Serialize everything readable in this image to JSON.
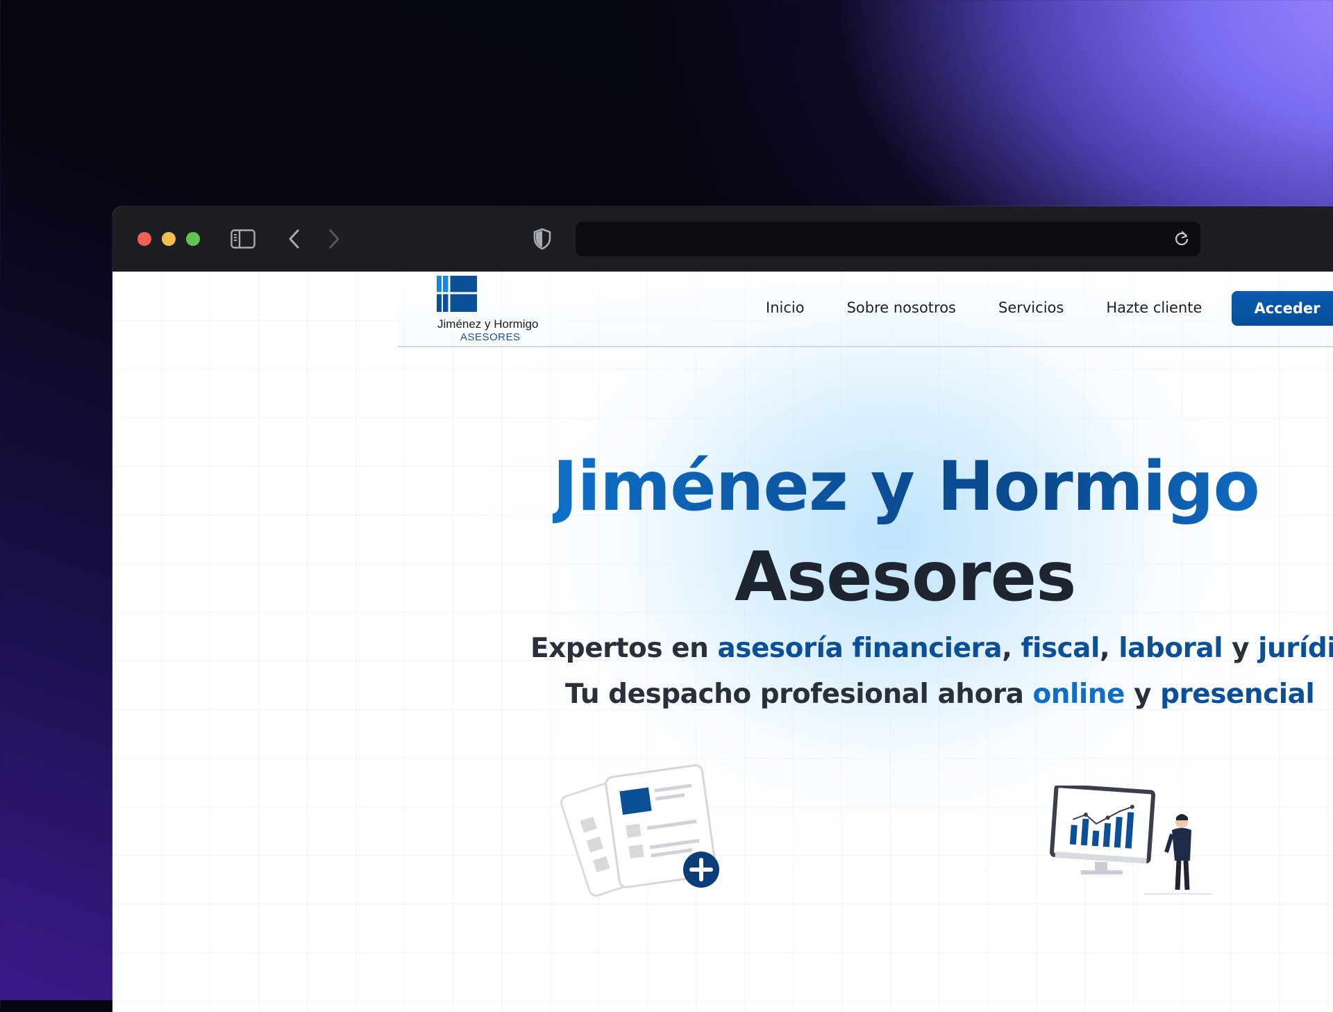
{
  "browser": {
    "url": ""
  },
  "site": {
    "logo": {
      "name": "Jiménez y Hormigo",
      "subtitle": "ASESORES"
    },
    "nav": {
      "links": [
        "Inicio",
        "Sobre nosotros",
        "Servicios",
        "Hazte cliente"
      ],
      "cta": "Acceder"
    },
    "hero": {
      "title_line1": "Jiménez y Hormigo",
      "title_line2": "Asesores",
      "subtitle1": {
        "prefix": "Expertos en ",
        "asesoria": "asesoría financiera",
        "comma1": ", ",
        "fiscal": "fiscal",
        "comma2": ", ",
        "laboral": "laboral",
        "y": " y ",
        "juridica": "jurídica"
      },
      "subtitle2": {
        "prefix": "Tu despacho profesional ahora ",
        "online": "online",
        "y": " y ",
        "presencial": "presencial"
      }
    }
  },
  "colors": {
    "brand_blue": "#0b4f97",
    "brand_light_blue": "#0e6fc7",
    "dark_text": "#1e2430"
  }
}
